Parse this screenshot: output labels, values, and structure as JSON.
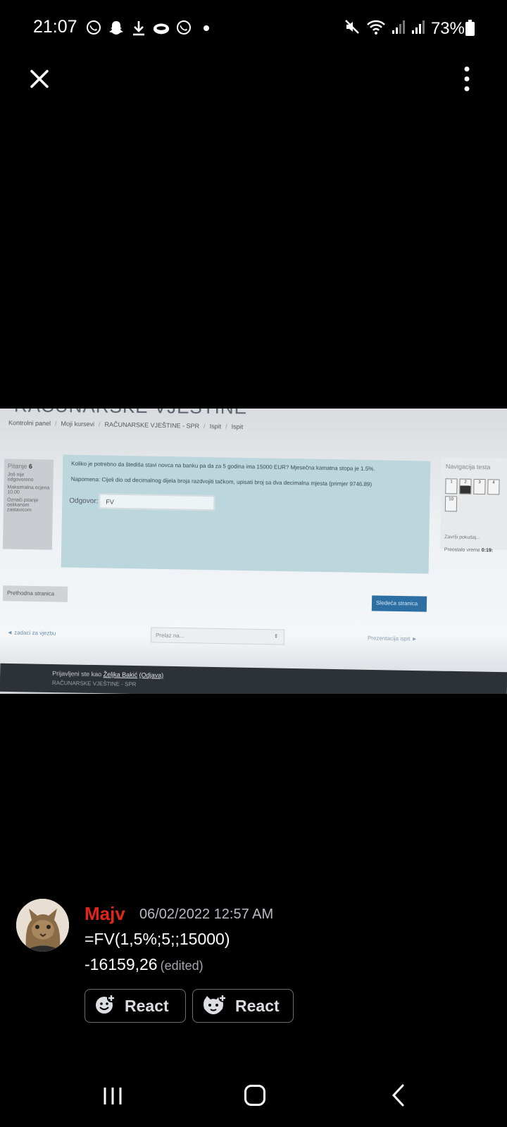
{
  "status_bar": {
    "time": "21:07",
    "battery": "73%",
    "notification_icons": [
      "viber-icon",
      "snapchat-icon",
      "download-icon",
      "cloud-icon",
      "viber-icon",
      "dot-icon"
    ],
    "system_icons": [
      "mute-icon",
      "wifi-icon",
      "signal-icon",
      "signal-icon",
      "battery-icon"
    ]
  },
  "viewer": {
    "close_icon": "close-icon",
    "menu_icon": "more-vertical-icon"
  },
  "photo": {
    "course_title": "RAČUNARSKE VJEŠTINE",
    "breadcrumb": [
      "Kontrolni panel",
      "Moji kursevi",
      "RAČUNARSKE VJEŠTINE - SPR",
      "Ispit",
      "Ispit"
    ],
    "question_info": {
      "label": "Pitanje",
      "number": "6",
      "status": "Još nije odgovoreno",
      "max_points": "Maksimalna ocjena 10,00",
      "flag": "Označi pitanje oslikanom zastavicom"
    },
    "question_text": "Koliko je potrebno da štediša stavi novca na banku pa da za 5 godina ima 15000 EUR? Mjesečna kamatna stopa je 1.5%.",
    "question_note": "Napomena: Cijeli dio od decimalnog dijela broja razdvojiti tačkom, upisati broj sa dva decimalna mjesta (primjer 9746.89)",
    "answer_label": "Odgovor:",
    "answer_value": "FV",
    "nav_title": "Navigacija testa",
    "nav_cells": [
      "1",
      "2",
      "3",
      "4",
      "10"
    ],
    "nav_finish": "Završi pokušaj...",
    "nav_time_label": "Preostalo vreme",
    "nav_time_value": "0:19:",
    "prev_button": "Prethodna stranica",
    "next_button": "Sledeća stranica",
    "back_link": "◄ zadaci za vjezbu",
    "jump_placeholder": "Prelaz na...",
    "presentation_link": "Prezentacija ispit ►",
    "footer_login_prefix": "Prijavljeni ste kao",
    "footer_user": "Željka Bakić",
    "footer_logout": "(Odjava)",
    "footer_course": "RAČUNARSKE VJEŠTINE - SPR"
  },
  "comment": {
    "username": "Majv",
    "timestamp": "06/02/2022 12:57 AM",
    "line1": "=FV(1,5%;5;;15000)",
    "line2": "-16159,26",
    "edited": "(edited)",
    "react_buttons": [
      {
        "label": "React",
        "icon": "add-reaction-icon"
      },
      {
        "label": "React",
        "icon": "add-sticker-icon"
      }
    ],
    "colors": {
      "username": "#e0251b",
      "timestamp": "#b9bbbe"
    }
  },
  "nav_bar": {
    "icons": [
      "recent-apps-icon",
      "home-icon",
      "back-icon"
    ]
  }
}
